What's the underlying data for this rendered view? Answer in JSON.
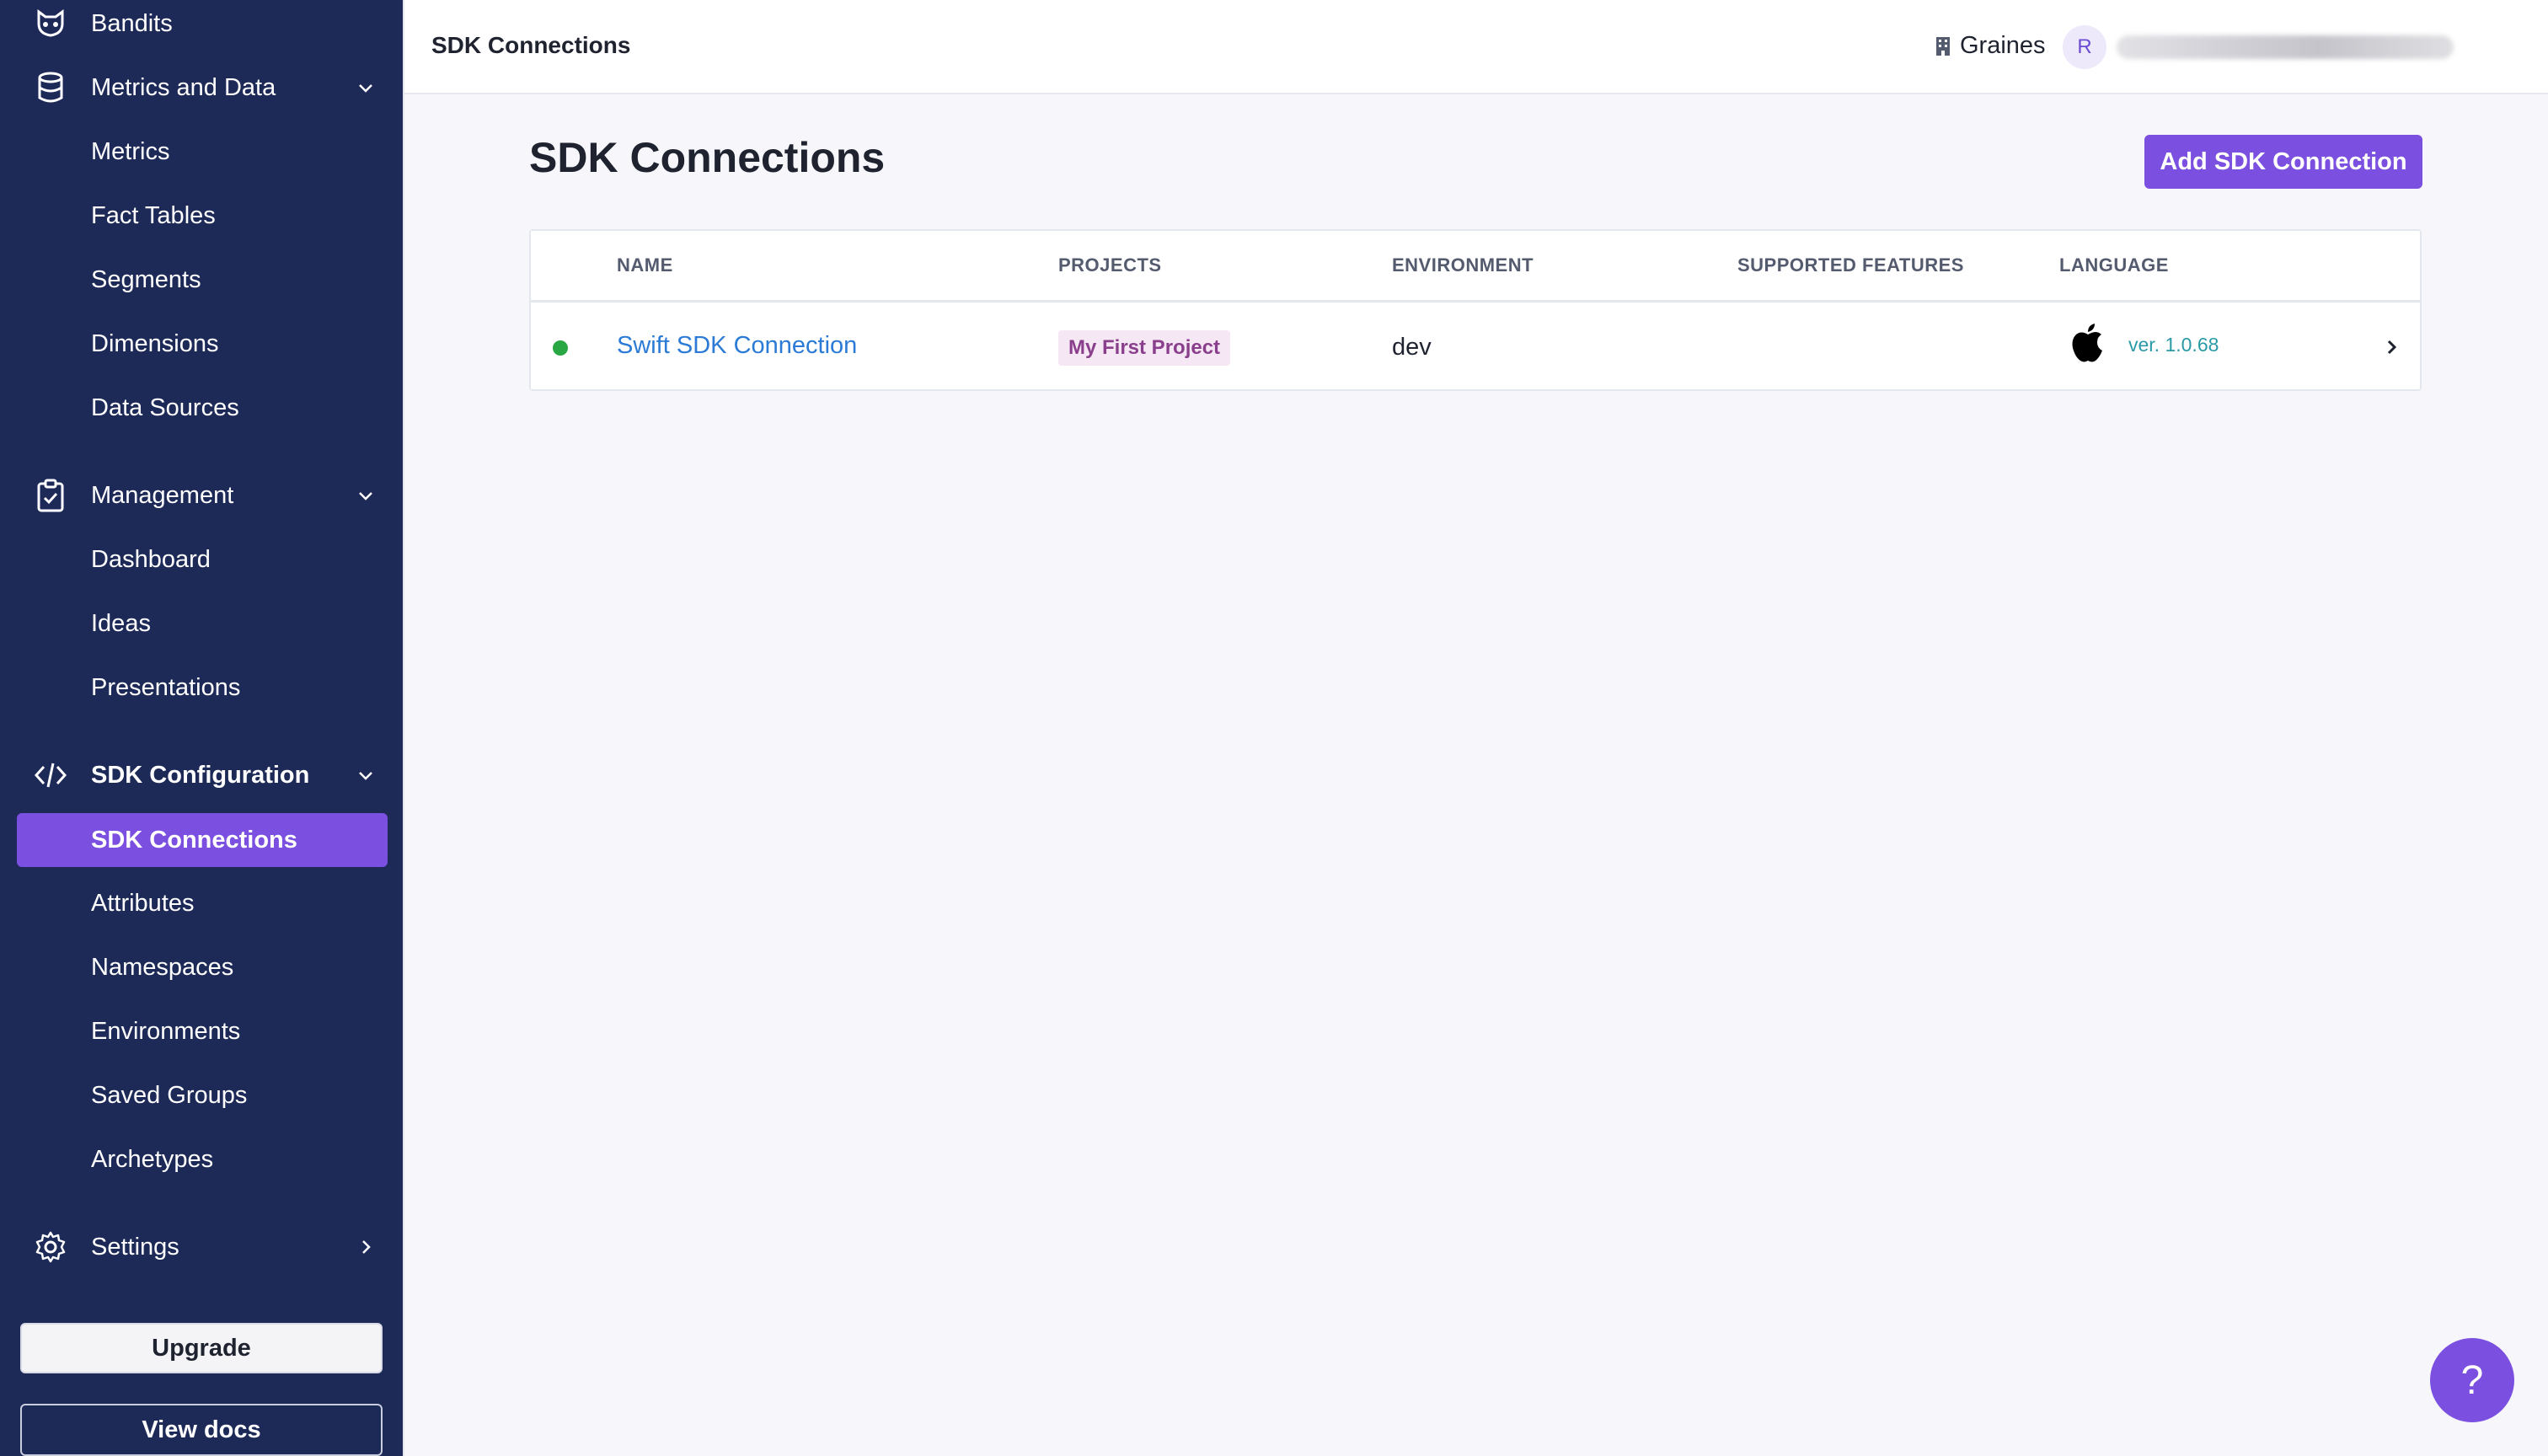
{
  "sidebar": {
    "items": [
      {
        "label": "Bandits",
        "icon": "raccoon-icon"
      },
      {
        "label": "Metrics and Data",
        "icon": "database-icon",
        "expanded": true,
        "children": [
          "Metrics",
          "Fact Tables",
          "Segments",
          "Dimensions",
          "Data Sources"
        ]
      },
      {
        "label": "Management",
        "icon": "clipboard-check-icon",
        "expanded": true,
        "children": [
          "Dashboard",
          "Ideas",
          "Presentations"
        ]
      },
      {
        "label": "SDK Configuration",
        "icon": "code-icon",
        "expanded": true,
        "children": [
          "SDK Connections",
          "Attributes",
          "Namespaces",
          "Environments",
          "Saved Groups",
          "Archetypes"
        ]
      },
      {
        "label": "Settings",
        "icon": "gear-icon",
        "expanded": false
      }
    ],
    "active_item": "SDK Connections",
    "upgrade_label": "Upgrade",
    "view_docs_label": "View docs"
  },
  "header": {
    "breadcrumb": "SDK Connections",
    "org_name": "Graines",
    "avatar_initial": "R"
  },
  "main": {
    "title": "SDK Connections",
    "add_button_label": "Add SDK Connection",
    "table": {
      "columns": [
        "NAME",
        "PROJECTS",
        "ENVIRONMENT",
        "SUPPORTED FEATURES",
        "LANGUAGE"
      ],
      "rows": [
        {
          "status": "connected",
          "name": "Swift SDK Connection",
          "project": "My First Project",
          "environment": "dev",
          "supported_features": "",
          "language_icon": "apple-icon",
          "version": "ver. 1.0.68"
        }
      ]
    }
  },
  "help_label": "?",
  "colors": {
    "sidebar_bg": "#1d2a58",
    "accent": "#7b4fe0",
    "link": "#2b7bd6",
    "status_ok": "#29a745",
    "version_text": "#2b9aa8"
  }
}
